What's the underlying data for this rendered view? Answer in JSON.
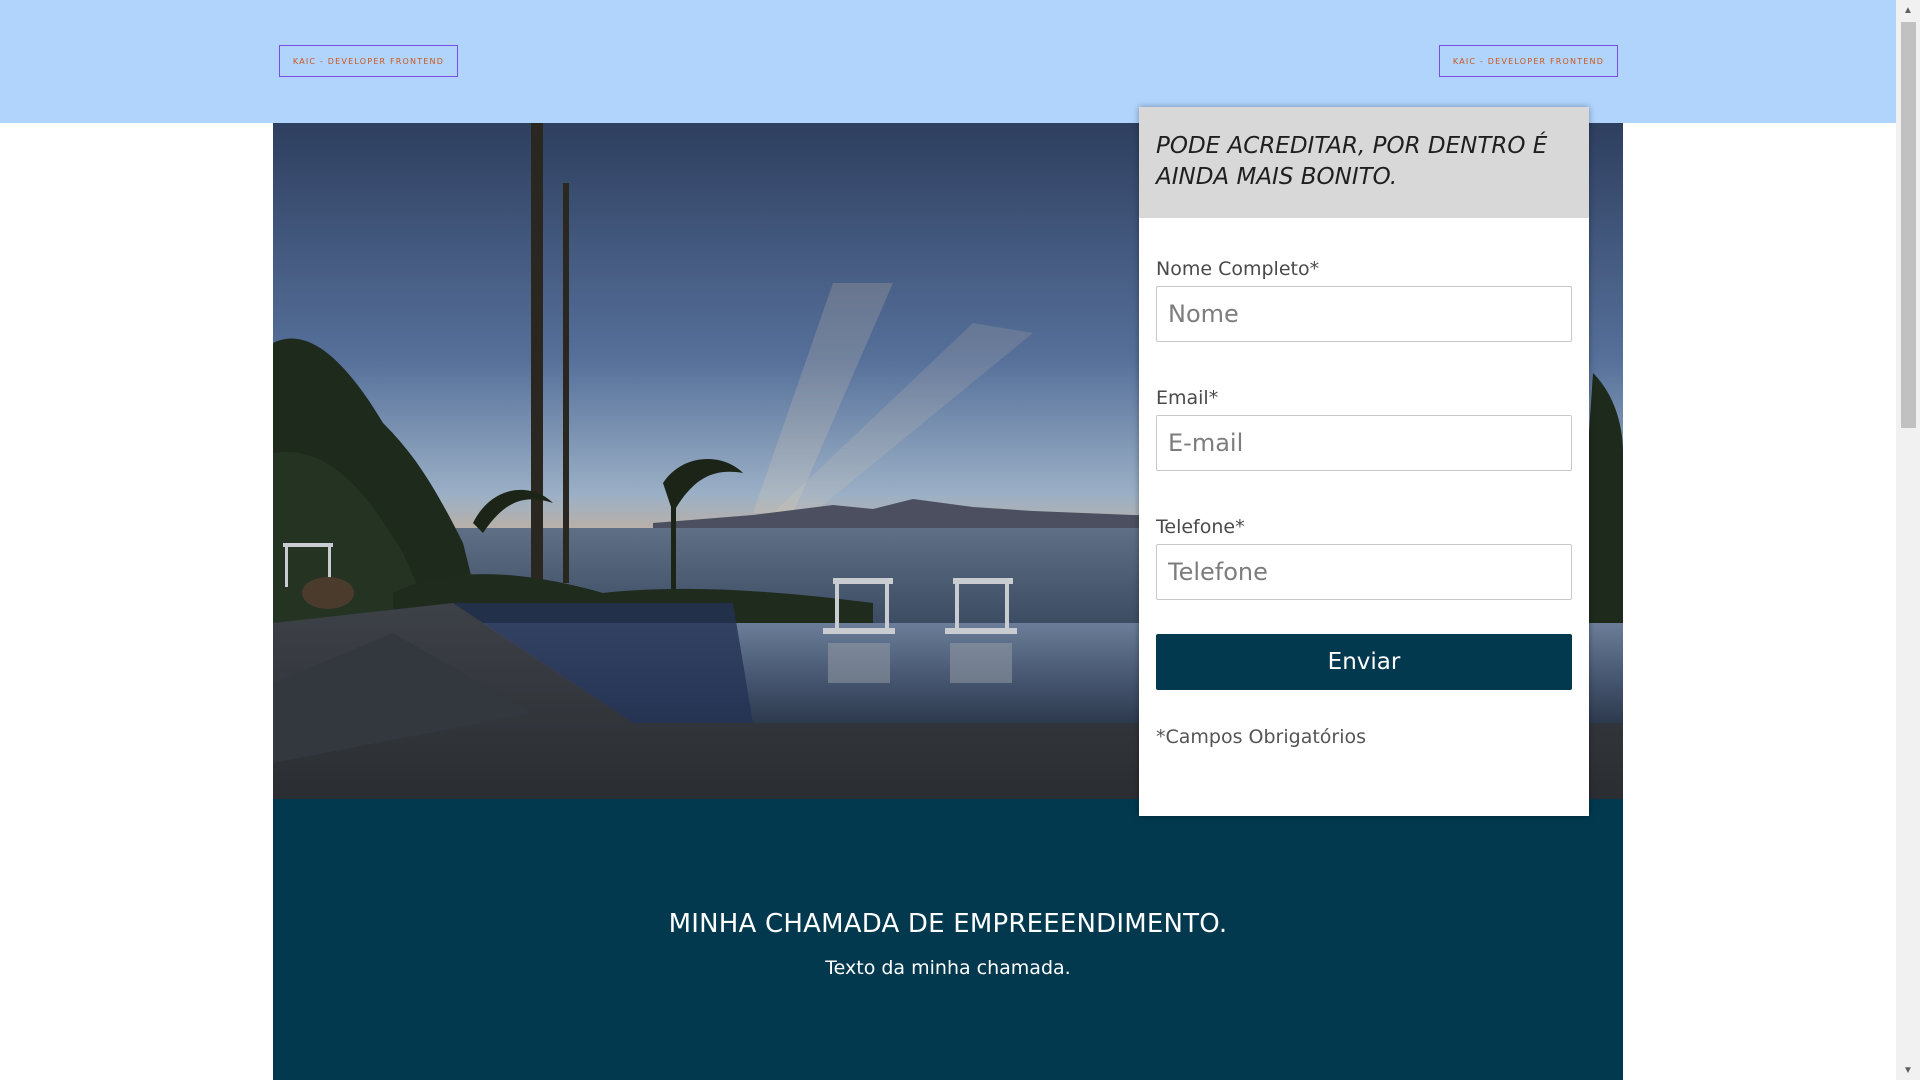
{
  "header": {
    "brand_left": "KAIC - DEVELOPER FRONTEND",
    "brand_right": "KAIC - DEVELOPER FRONTEND"
  },
  "form": {
    "title": "PODE ACREDITAR, POR DENTRO É AINDA MAIS BONITO.",
    "fields": [
      {
        "label": "Nome Completo*",
        "placeholder": "Nome",
        "value": ""
      },
      {
        "label": "Email*",
        "placeholder": "E-mail",
        "value": ""
      },
      {
        "label": "Telefone*",
        "placeholder": "Telefone",
        "value": ""
      }
    ],
    "submit_label": "Enviar",
    "required_note": "*Campos Obrigatórios"
  },
  "band": {
    "title": "MINHA CHAMADA DE EMPREEENDIMENTO.",
    "subtitle": "Texto da minha chamada."
  },
  "colors": {
    "header_bg": "#b0d4fc",
    "brand_border": "#7b4fe6",
    "brand_text": "#d0551a",
    "accent_dark": "#02394f",
    "form_head_bg": "#d8d8d8"
  },
  "icons": {
    "scroll_up": "scroll-up-arrow-icon",
    "scroll_down": "scroll-down-arrow-icon"
  }
}
